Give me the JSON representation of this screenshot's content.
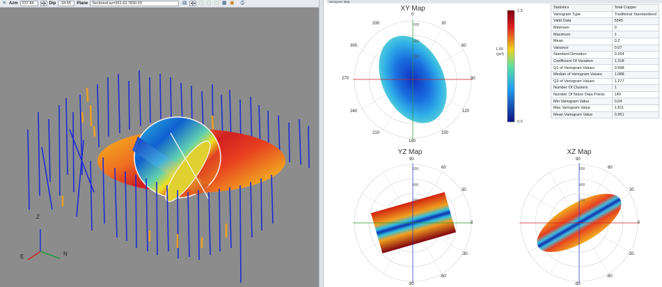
{
  "toolbar": {
    "azm_label": "Azm",
    "azm_value": "237.84",
    "dip_label": "Dip",
    "dip_value": "-34.55",
    "plane_label": "Plane",
    "plane_value": "Sectional az=351.63 7830.93"
  },
  "viewport": {
    "axis_z": "Z",
    "axis_e": "E",
    "axis_n": "N"
  },
  "panel": {
    "tab_title": "Variogram Map"
  },
  "xy_map": {
    "title": "XY Map",
    "angle_labels": [
      "0",
      "30",
      "60",
      "90",
      "120",
      "150",
      "180",
      "210",
      "240",
      "270",
      "300",
      "330"
    ],
    "radius_labels": [
      "600",
      "400",
      "200"
    ]
  },
  "yz_map": {
    "title": "YZ Map",
    "angle_labels": [
      "90",
      "60",
      "30",
      "0",
      "-30",
      "-60",
      "-90"
    ],
    "radius_labels": [
      "600",
      "400",
      "200"
    ]
  },
  "xz_map": {
    "title": "XZ Map",
    "angle_labels": [
      "90",
      "60",
      "30",
      "0",
      "-30",
      "-60",
      "-90"
    ],
    "radius_labels": [
      "600",
      "400",
      "200"
    ]
  },
  "colorbar": {
    "max": "1.5",
    "mid": "1.00",
    "unit": "(pct)",
    "min": "0.0"
  },
  "stats": {
    "header": [
      "Statistics",
      "Total Copper"
    ],
    "rows": [
      [
        "Variogram Type",
        "Traditional Standardized"
      ],
      [
        "Valid Data",
        "5345"
      ],
      [
        "Minimum",
        "0"
      ],
      [
        "Maximum",
        "1"
      ],
      [
        "Mean",
        "0.2"
      ],
      [
        "Variance",
        "0.07"
      ],
      [
        "Standard Deviation",
        "0.264"
      ],
      [
        "Coefficient Of Variation",
        "1.318"
      ],
      [
        "Q1 of Variogram Values",
        "0.598"
      ],
      [
        "Median of Variogram Values",
        "1.088"
      ],
      [
        "Q3 of Variogram Values",
        "1.277"
      ],
      [
        "Number Of Clusters",
        "1"
      ],
      [
        "Number Of Noise Data Points",
        "140"
      ],
      [
        "Min Variogram Value",
        "0.04"
      ],
      [
        "Max Variogram Value",
        "1.811"
      ],
      [
        "Mean Variogram Value",
        "0.951"
      ]
    ]
  },
  "colors": {
    "drillhole": "#1a2bd6",
    "grade_high": "#f0a020",
    "background_3d": "#8c8c8c",
    "axis_x": "#d02020",
    "axis_y": "#20a040",
    "axis_z": "#2030d0"
  }
}
